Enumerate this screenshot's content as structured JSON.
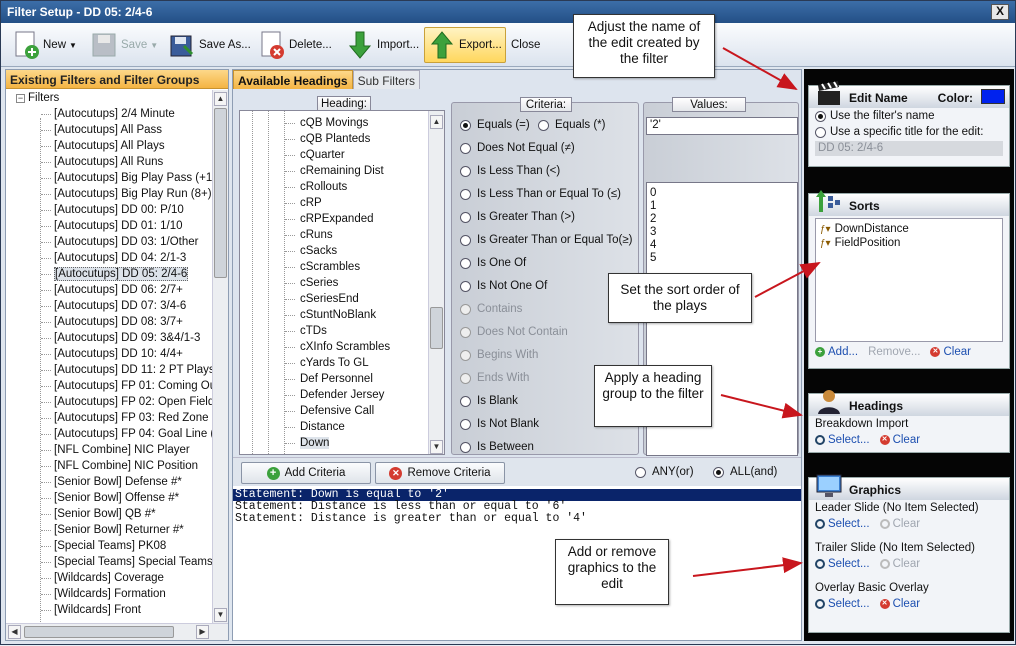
{
  "window": {
    "title": "Filter Setup - DD 05: 2/4-6",
    "close_label": "X"
  },
  "toolbar": {
    "new_label": "New",
    "save_label": "Save",
    "save_as_label": "Save As...",
    "delete_label": "Delete...",
    "import_label": "Import...",
    "export_label": "Export...",
    "close_label": "Close"
  },
  "left_pane": {
    "header": "Existing Filters and Filter Groups",
    "root_label": "Filters",
    "items": [
      "[Autocutups] 2/4 Minute",
      "[Autocutups] All Pass",
      "[Autocutups] All Plays",
      "[Autocutups] All Runs",
      "[Autocutups] Big Play Pass (+12)",
      "[Autocutups] Big Play Run (8+)",
      "[Autocutups] DD 00: P/10",
      "[Autocutups] DD 01: 1/10",
      "[Autocutups] DD 03: 1/Other",
      "[Autocutups] DD 04: 2/1-3",
      "[Autocutups] DD 05: 2/4-6",
      "[Autocutups] DD 06: 2/7+",
      "[Autocutups] DD 07: 3/4-6",
      "[Autocutups] DD 08: 3/7+",
      "[Autocutups] DD 09: 3&4/1-3",
      "[Autocutups] DD 10: 4/4+",
      "[Autocutups] DD 11: 2 PT Plays",
      "[Autocutups] FP 01: Coming Out (-",
      "[Autocutups] FP 02: Open Field (-1",
      "[Autocutups] FP 03: Red Zone (+2",
      "[Autocutups] FP 04: Goal Line (+4",
      "[NFL Combine] NIC Player",
      "[NFL Combine] NIC Position",
      "[Senior Bowl] Defense #*",
      "[Senior Bowl] Offense #*",
      "[Senior Bowl] QB #*",
      "[Senior Bowl] Returner #*",
      "[Special Teams] PK08",
      "[Special Teams] Special Teams",
      "[Wildcards] Coverage",
      "[Wildcards] Formation",
      "[Wildcards] Front"
    ],
    "selected_index": 10
  },
  "tabs": {
    "available": "Available Headings",
    "sub": "Sub Filters"
  },
  "headings": {
    "header": "Heading:",
    "items": [
      "cQB Movings",
      "cQB Planteds",
      "cQuarter",
      "cRemaining Dist",
      "cRollouts",
      "cRP",
      "cRPExpanded",
      "cRuns",
      "cSacks",
      "cScrambles",
      "cSeries",
      "cSeriesEnd",
      "cStuntNoBlank",
      "cTDs",
      "cXInfo Scrambles",
      "cYards To GL",
      "Def Personnel",
      "Defender Jersey",
      "Defensive Call",
      "Distance",
      "Down"
    ],
    "selected": "Down"
  },
  "criteria": {
    "header": "Criteria:",
    "equals_eq": "Equals (=)",
    "equals_star": "Equals (*)",
    "options": [
      {
        "label": "Does Not Equal (≠)",
        "enabled": true
      },
      {
        "label": "Is Less Than (<)",
        "enabled": true
      },
      {
        "label": "Is Less Than or Equal To (≤)",
        "enabled": true
      },
      {
        "label": "Is Greater Than (>)",
        "enabled": true
      },
      {
        "label": "Is Greater Than or Equal To(≥)",
        "enabled": true
      },
      {
        "label": "Is One Of",
        "enabled": true
      },
      {
        "label": "Is Not One Of",
        "enabled": true
      },
      {
        "label": "Contains",
        "enabled": false
      },
      {
        "label": "Does Not Contain",
        "enabled": false
      },
      {
        "label": "Begins With",
        "enabled": false
      },
      {
        "label": "Ends With",
        "enabled": false
      },
      {
        "label": "Is Blank",
        "enabled": true
      },
      {
        "label": "Is Not Blank",
        "enabled": true
      },
      {
        "label": "Is Between",
        "enabled": true
      }
    ]
  },
  "values": {
    "header": "Values:",
    "input": "'2'",
    "list": [
      "0",
      "1",
      "2",
      "3",
      "4",
      "5"
    ]
  },
  "actions": {
    "add_criteria": "Add Criteria",
    "remove_criteria": "Remove Criteria",
    "any_label": "ANY(or)",
    "all_label": "ALL(and)",
    "selected": "all"
  },
  "statements": [
    "Statement: Down is equal to '2'",
    "Statement: Distance is less than or equal to '6'",
    "Statement: Distance is greater than or equal to '4'"
  ],
  "edit_name": {
    "title": "Edit Name",
    "color_label": "Color:",
    "color": "#0022ee",
    "opt_filter_name": "Use the filter's name",
    "opt_specific": "Use a specific title for the edit:",
    "title_value": "DD 05: 2/4-6"
  },
  "sorts": {
    "title": "Sorts",
    "items": [
      "DownDistance",
      "FieldPosition"
    ],
    "add": "Add...",
    "remove": "Remove...",
    "clear": "Clear"
  },
  "headings_section": {
    "title": "Headings",
    "value": "Breakdown Import",
    "select": "Select...",
    "clear": "Clear"
  },
  "graphics": {
    "title": "Graphics",
    "leader": "Leader Slide (No Item Selected)",
    "trailer": "Trailer Slide (No Item Selected)",
    "overlay": "Overlay Basic Overlay",
    "select": "Select...",
    "clear": "Clear"
  },
  "callouts": {
    "edit_name": "Adjust the name of the edit created by the filter",
    "sort": "Set the sort order of the plays",
    "heading_group": "Apply a heading group to the filter",
    "graphics": "Add or remove graphics to the edit"
  }
}
